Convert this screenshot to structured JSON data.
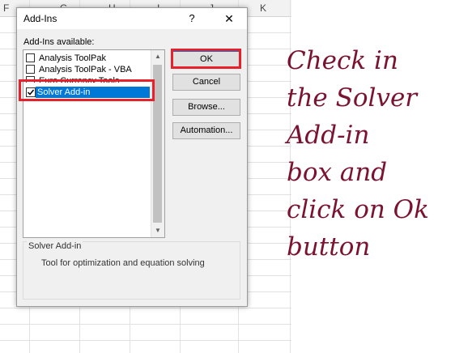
{
  "sheet": {
    "columns": [
      "F",
      "G",
      "H",
      "I",
      "J",
      "K"
    ]
  },
  "dialog": {
    "title": "Add-Ins",
    "help_glyph": "?",
    "close_glyph": "✕",
    "list_label": "Add-Ins available:",
    "items": [
      {
        "label": "Analysis ToolPak",
        "checked": false
      },
      {
        "label": "Analysis ToolPak - VBA",
        "checked": false
      },
      {
        "label": "Euro Currency Tools",
        "checked": false
      },
      {
        "label": "Solver Add-in",
        "checked": true
      }
    ],
    "buttons": {
      "ok": "OK",
      "cancel": "Cancel",
      "browse": "Browse...",
      "automation": "Automation..."
    },
    "description_group": {
      "title": "Solver Add-in",
      "text": "Tool for optimization and equation solving"
    },
    "highlight_color": "#e8202a"
  },
  "annotation": {
    "lines": [
      "Check in",
      "the Solver",
      "Add-in",
      "box and",
      "click on Ok",
      "button"
    ],
    "color": "#7a1230"
  }
}
